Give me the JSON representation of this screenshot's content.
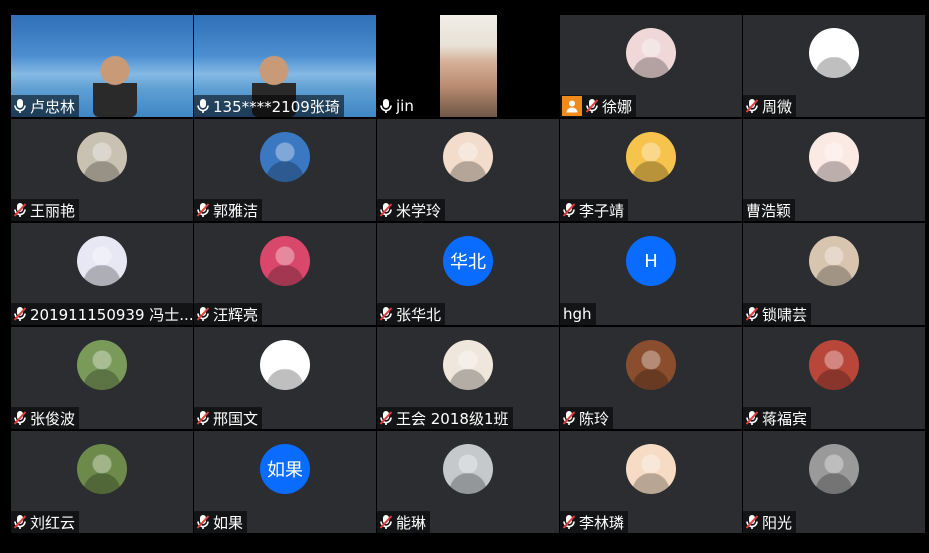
{
  "participants": [
    {
      "name": "卢忠林",
      "mic": "on",
      "kind": "video-blue"
    },
    {
      "name": "135****2109张琦",
      "mic": "on",
      "kind": "video-blue"
    },
    {
      "name": "jin",
      "mic": "on",
      "kind": "video-face"
    },
    {
      "name": "徐娜",
      "mic": "muted",
      "kind": "avatar",
      "host": true,
      "avatar_icon": "cartoon-girl-icon",
      "avatar_color": "#f0d8d8"
    },
    {
      "name": "周微",
      "mic": "muted",
      "kind": "avatar",
      "avatar_icon": "cartoon-sticker-icon",
      "avatar_color": "#ffffff"
    },
    {
      "name": "王丽艳",
      "mic": "muted",
      "kind": "avatar",
      "avatar_icon": "photo-couple-icon",
      "avatar_color": "#c9c2b3"
    },
    {
      "name": "郭雅洁",
      "mic": "muted",
      "kind": "avatar",
      "avatar_icon": "photo-girl-icon",
      "avatar_color": "#3a78c2"
    },
    {
      "name": "米学玲",
      "mic": "muted",
      "kind": "avatar",
      "avatar_icon": "penguin-icon",
      "avatar_color": "#f2dccb"
    },
    {
      "name": "李子靖",
      "mic": "muted",
      "kind": "avatar",
      "avatar_icon": "anime-girl-icon",
      "avatar_color": "#f6c44c"
    },
    {
      "name": "曹浩颖",
      "mic": "none",
      "kind": "avatar",
      "avatar_icon": "cartoon-princess-icon",
      "avatar_color": "#fbe9e4"
    },
    {
      "name": "201911150939 冯士...",
      "mic": "muted",
      "kind": "avatar",
      "avatar_icon": "university-badge-icon",
      "avatar_color": "#e8e8f4"
    },
    {
      "name": "汪辉亮",
      "mic": "muted",
      "kind": "avatar",
      "avatar_icon": "sunset-icon",
      "avatar_color": "#d9486a"
    },
    {
      "name": "张华北",
      "mic": "muted",
      "kind": "avatar-text",
      "avatar_text": "华北"
    },
    {
      "name": "hgh",
      "mic": "none",
      "kind": "avatar-text",
      "avatar_text": "H"
    },
    {
      "name": "锁啸芸",
      "mic": "muted",
      "kind": "avatar",
      "avatar_icon": "cat-meme-icon",
      "avatar_color": "#d8c5b0"
    },
    {
      "name": "张俊波",
      "mic": "muted",
      "kind": "avatar",
      "avatar_icon": "landscape-tree-icon",
      "avatar_color": "#7a9a5a"
    },
    {
      "name": "邢国文",
      "mic": "muted",
      "kind": "avatar",
      "avatar_icon": "deer-icon",
      "avatar_color": "#ffffff"
    },
    {
      "name": "王会 2018级1班",
      "mic": "muted",
      "kind": "avatar",
      "avatar_icon": "ink-painting-icon",
      "avatar_color": "#efe7dc"
    },
    {
      "name": "陈玲",
      "mic": "muted",
      "kind": "avatar",
      "avatar_icon": "bread-icon",
      "avatar_color": "#8a4d2e"
    },
    {
      "name": "蒋福宾",
      "mic": "muted",
      "kind": "avatar",
      "avatar_icon": "autumn-tree-icon",
      "avatar_color": "#b8473a"
    },
    {
      "name": "刘红云",
      "mic": "muted",
      "kind": "avatar",
      "avatar_icon": "flowers-icon",
      "avatar_color": "#6d8a4a"
    },
    {
      "name": "如果",
      "mic": "muted",
      "kind": "avatar-text",
      "avatar_text": "如果"
    },
    {
      "name": "能琳",
      "mic": "muted",
      "kind": "avatar",
      "avatar_icon": "photo-woman-icon",
      "avatar_color": "#c5c9cc"
    },
    {
      "name": "李林璘",
      "mic": "muted",
      "kind": "avatar",
      "avatar_icon": "cartoon-reader-icon",
      "avatar_color": "#f6dcc4"
    },
    {
      "name": "阳光",
      "mic": "muted",
      "kind": "avatar",
      "avatar_icon": "photo-man-icon",
      "avatar_color": "#9a9a9a"
    }
  ],
  "colors": {
    "tile_bg": "#2b2d30",
    "text_avatar_bg": "#0a6cff",
    "muted_slash": "#e23b3b",
    "host_badge": "#f08a1a"
  }
}
